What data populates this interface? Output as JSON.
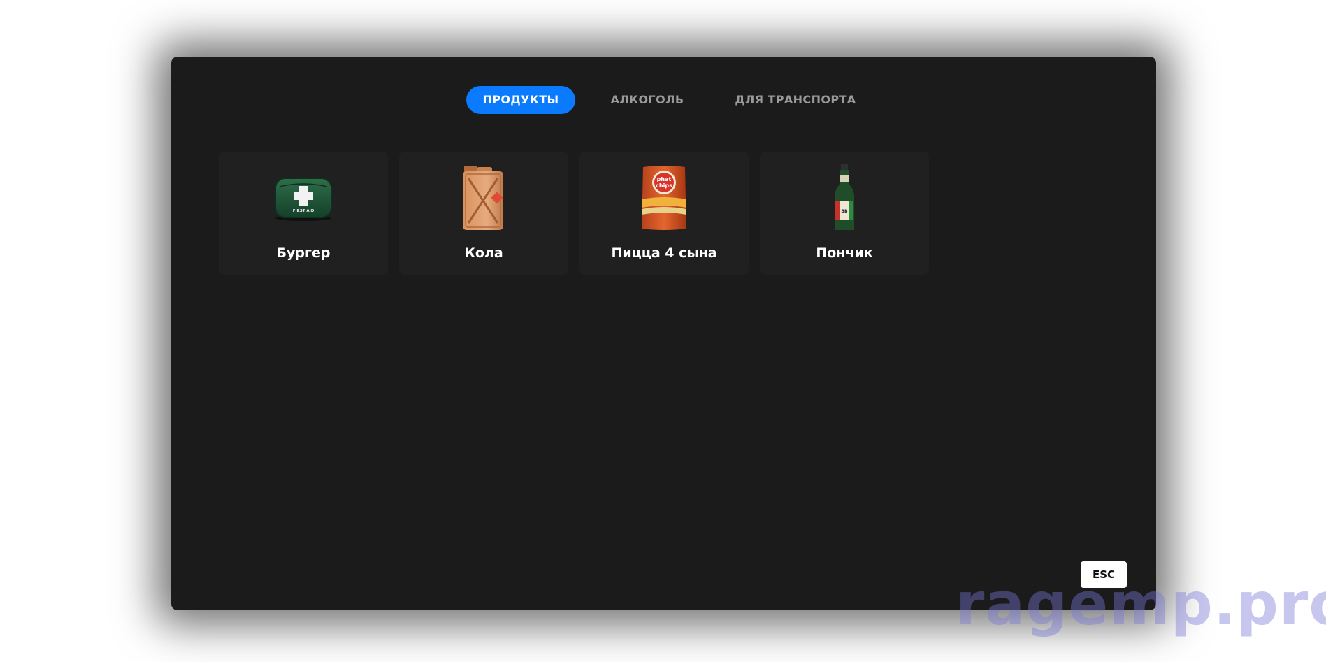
{
  "tabs": [
    {
      "label": "ПРОДУКТЫ",
      "active": true
    },
    {
      "label": "АЛКОГОЛЬ",
      "active": false
    },
    {
      "label": "ДЛЯ ТРАНСПОРТА",
      "active": false
    }
  ],
  "items": [
    {
      "name": "Бургер",
      "icon": "first-aid-kit-icon"
    },
    {
      "name": "Кола",
      "icon": "jerry-can-icon"
    },
    {
      "name": "Пицца 4 сына",
      "icon": "chips-bag-icon"
    },
    {
      "name": "Пончик",
      "icon": "beer-bottle-icon"
    }
  ],
  "close_button": {
    "label": "ESC"
  },
  "watermark": {
    "text": "ragemp.pro"
  },
  "colors": {
    "panel": "#1b1b1b",
    "card": "#202020",
    "accent": "#0a7bff",
    "inactive_tab": "#9a9a9a",
    "watermark": "#7878d7"
  }
}
